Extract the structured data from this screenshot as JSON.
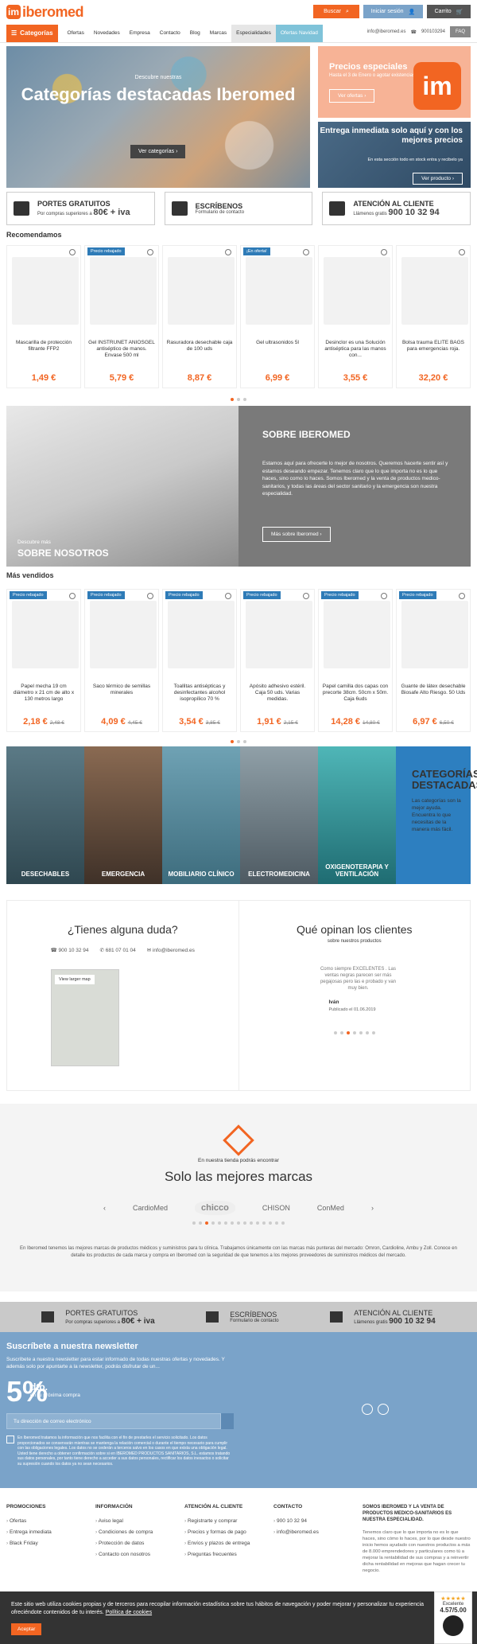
{
  "header": {
    "logo_text": "iberomed",
    "search_label": "Buscar",
    "login_label": "Iniciar sesión",
    "cart_label": "Carrito"
  },
  "nav": {
    "categories_label": "Categorías",
    "items": [
      "Ofertas",
      "Novedades",
      "Empresa",
      "Contacto",
      "Blog",
      "Marcas",
      "Especialidades",
      "Ofertas Navidad"
    ],
    "email": "info@iberomed.es",
    "phone": "900103294",
    "faq_label": "FAQ"
  },
  "hero": {
    "subtitle": "Descubre nuestras",
    "title": "Categorías destacadas Iberomed",
    "button": "Ver categorías"
  },
  "promo_prices": {
    "title": "Precios especiales",
    "subtitle": "Hasta el 3 de Enero o agotar existencias",
    "button": "Ver ofertas",
    "logo": "im"
  },
  "promo_delivery": {
    "title": "Entrega inmediata solo aquí y con los mejores precios",
    "subtitle": "En esta sección todo en stock entra y recibelo ya",
    "button": "Ver producto"
  },
  "info_boxes": [
    {
      "title": "PORTES GRATUITOS",
      "sub": "Por compras superiores a",
      "bold": "80€ + iva"
    },
    {
      "title": "ESCRÍBENOS",
      "sub": "Formulario de contacto",
      "bold": ""
    },
    {
      "title": "ATENCIÓN AL CLIENTE",
      "sub": "Llámenos gratis",
      "bold": "900 10 32 94"
    }
  ],
  "recommended": {
    "title": "Recomendamos",
    "products": [
      {
        "badge": "",
        "name": "Mascarilla de protección filtrante FFP2",
        "price": "1,49 €",
        "old": ""
      },
      {
        "badge": "Precio rebajado",
        "name": "Gel INSTRUNET ANIOSGEL antiséptico de manos. Envase 500 ml",
        "price": "5,79 €",
        "old": ""
      },
      {
        "badge": "",
        "name": "Rasuradora desechable caja de 100 uds",
        "price": "8,87 €",
        "old": ""
      },
      {
        "badge": "¡En oferta!",
        "name": "Gel ultrasonidos 5l",
        "price": "6,99 €",
        "old": ""
      },
      {
        "badge": "",
        "name": "Desinclor es una Solución antiséptica para las manos con...",
        "price": "3,55 €",
        "old": ""
      },
      {
        "badge": "",
        "name": "Bolsa trauma ELITE BAGS para emergencias roja.",
        "price": "32,20 €",
        "old": ""
      }
    ]
  },
  "about": {
    "small": "Descubre más",
    "big": "SOBRE NOSOTROS",
    "title": "SOBRE IBEROMED",
    "text": "Estamos aquí para ofrecerte lo mejor de nosotros. Queremos hacerte sentir así y estamos deseando empezar. Tenemos claro que lo que importa no es lo que haces, sino como lo haces. Somos Iberomed y la venta de productos medico-sanitarios, y todas las áreas del sector sanitario y la emergencia son nuestra especialidad.",
    "button": "Más sobre Iberomed"
  },
  "bestsellers": {
    "title": "Más vendidos",
    "products": [
      {
        "badge": "Precio rebajado",
        "name": "Papel mecha 19 cm diámetro x 21 cm de alto x 130 metros largo",
        "price": "2,18 €",
        "old": "2,48 €"
      },
      {
        "badge": "Precio rebajado",
        "name": "Saco térmico de semillas minerales",
        "price": "4,09 €",
        "old": "4,45 €"
      },
      {
        "badge": "Precio rebajado",
        "name": "Toallitas antisépticas y desinfectantes alcohol isopropílico 70 %",
        "price": "3,54 €",
        "old": "3,85 €"
      },
      {
        "badge": "Precio rebajado",
        "name": "Apósito adhesivo estéril. Caja 50 uds. Varias medidas.",
        "price": "1,91 €",
        "old": "2,15 €"
      },
      {
        "badge": "Precio rebajado",
        "name": "Papel camilla dos capas con precorte 38cm. 50cm x 50m. Caja 6uds",
        "price": "14,28 €",
        "old": "14,80 €"
      },
      {
        "badge": "Precio rebajado",
        "name": "Guante de látex desechable Biosafe Alto Riesgo. 50 Uds",
        "price": "6,97 €",
        "old": "6,50 €"
      }
    ]
  },
  "categories": {
    "items": [
      "DESECHABLES",
      "EMERGENCIA",
      "MOBILIARIO CLÍNICO",
      "ELECTROMEDICINA",
      "OXIGENOTERAPIA Y VENTILACIÓN"
    ],
    "featured_title": "CATEGORÍAS DESTACADAS",
    "featured_text": "Las categorías son la mejor ayuda. Encuentra lo que necesitas de la manera más fácil."
  },
  "doubt": {
    "title": "¿Tienes alguna duda?",
    "phone1": "900 10 32 94",
    "phone2": "681 07 01 04",
    "email": "info@iberomed.es",
    "map_button": "View larger map"
  },
  "reviews": {
    "title": "Qué opinan los clientes",
    "subtitle": "sobre nuestros productos",
    "text": "Como siempre EXCELENTES . Las ventas negras parecen ser más pegajosas pero las e probado y van muy bien.",
    "author": "Iván",
    "date": "Publicado el 01.06.2019"
  },
  "brands": {
    "pre": "En nuestra tienda podrás encontrar",
    "title": "Solo las mejores marcas",
    "logos": [
      "CardioMed",
      "chicco",
      "CHISON",
      "ConMed"
    ],
    "text": "En Iberomed tenemos las mejores marcas de productos médicos y suministros para tu clínica. Trabajamos únicamente con las marcas más punteras del mercado: Omron, Cardioline, Ambu y Zoll. Conoce en detalle los productos de cada marca y compra en Iberomed con la seguridad de que tenemos a los mejores proveedores de suministros médicos del mercado."
  },
  "newsletter": {
    "title": "Suscríbete a nuestra newsletter",
    "desc": "Suscríbete a nuestra newsletter para estar informado de todas nuestras ofertas y novedades. Y además solo por apuntarte a la newsletter, podrás disfrutar de un...",
    "percent": "5%",
    "dto": "dto.",
    "next": "en tu próxima compra",
    "placeholder": "Tu dirección de correo electrónico",
    "legal": "En Iberomed tratamos la información que nos facilita con el fin de prestarles el servicio solicitado. Los datos proporcionados se conservarán mientras se mantenga la relación comercial o durante el tiempo necesario para cumplir con las obligaciones legales. Los datos no se cederán a terceros salvo en los casos en que exista una obligación legal. Usted tiene derecho a obtener confirmación sobre si en IBEROMED PRODUCTOS SANITARIOS, S.L. estamos tratando sus datos personales, por tanto tiene derecho a acceder a sus datos personales, rectificar los datos inexactos o solicitar su supresión cuando los datos ya no sean necesarios."
  },
  "footer": {
    "cols": [
      {
        "title": "PROMOCIONES",
        "items": [
          "Ofertas",
          "Entrega inmediata",
          "Black Friday"
        ]
      },
      {
        "title": "INFORMACIÓN",
        "items": [
          "Aviso legal",
          "Condiciones de compra",
          "Protección de datos",
          "Contacto con nosotros"
        ]
      },
      {
        "title": "ATENCIÓN AL CLIENTE",
        "items": [
          "Registrarte y comprar",
          "Precios y formas de pago",
          "Envíos y plazos de entrega",
          "Preguntas frecuentes"
        ]
      },
      {
        "title": "CONTACTO",
        "items": [
          "900 10 32 94",
          "info@iberomed.es"
        ]
      }
    ],
    "about_title": "SOMOS IBEROMED Y LA VENTA DE PRODUCTOS MEDICO-SANITARIOS ES NUESTRA ESPECIALIDAD.",
    "about_text": "Tenemos claro que lo que importa no es lo que haces, sino cómo lo haces, por lo que desde nuestro inicio hemos ayudado con nuestros productos a más de 8.000 emprendedores y particulares como tú a mejorar la rentabilidad de sus compras y a reinvertir dicha rentabilidad en mejoras que hagan crecer tu negocio."
  },
  "cookie": {
    "text": "Este sitio web utiliza cookies propias y de terceros para recopilar información estadística sobre tus hábitos de navegación y poder mejorar y personalizar tu experiencia ofreciéndote contenidos de tu interés.",
    "link": "Política de cookies",
    "button": "Aceptar"
  },
  "trust": {
    "label": "Excelente",
    "score": "4.57/5.00"
  }
}
